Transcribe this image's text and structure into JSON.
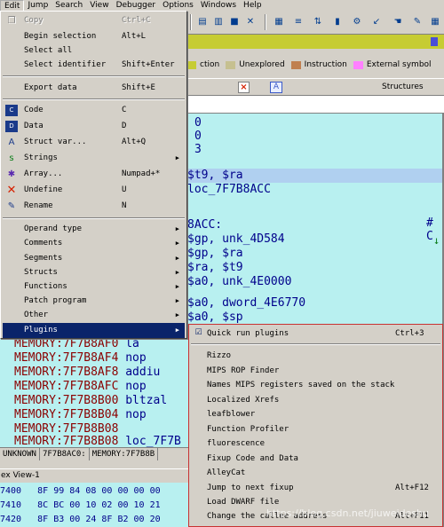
{
  "menubar": {
    "items": [
      "Edit",
      "Jump",
      "Search",
      "View",
      "Debugger",
      "Options",
      "Windows",
      "Help"
    ]
  },
  "legend": {
    "items": [
      {
        "label": "ction",
        "color": "#c6cc33"
      },
      {
        "label": "Unexplored",
        "color": "#c6c090"
      },
      {
        "label": "Instruction",
        "color": "#c08050"
      },
      {
        "label": "External symbol",
        "color": "#ff80ff"
      }
    ]
  },
  "tabs": {
    "close": "×",
    "structs_icon": "A",
    "structs": "Structures"
  },
  "listing": {
    "top_lines": [
      "0",
      "0",
      "3"
    ],
    "lines": [
      {
        "text": "$t9, $ra",
        "selected": true
      },
      {
        "text": "loc_7F7B8ACC"
      },
      {
        "text": "8ACC:"
      },
      {
        "text": "$gp, unk_4D584"
      },
      {
        "text": "$gp, $ra"
      },
      {
        "text": "$ra, $t9"
      },
      {
        "text": "$a0, unk_4E0000"
      },
      {
        "text": "$a0, dword_4E6770"
      },
      {
        "text": "$a0, $sp"
      }
    ],
    "comment": "# C",
    "memory_rows": [
      {
        "addr": "MEMORY:7F7B8AF0",
        "op": "la"
      },
      {
        "addr": "MEMORY:7F7B8AF4",
        "op": "nop"
      },
      {
        "addr": "MEMORY:7F7B8AF8",
        "op": "addiu"
      },
      {
        "addr": "MEMORY:7F7B8AFC",
        "op": "nop"
      },
      {
        "addr": "MEMORY:7F7B8B00",
        "op": "bltzal"
      },
      {
        "addr": "MEMORY:7F7B8B04",
        "op": "nop"
      },
      {
        "addr": "MEMORY:7F7B8B08",
        "op": ""
      },
      {
        "addr": "MEMORY:7F7B8B08",
        "op": "loc_7F7B"
      }
    ]
  },
  "status": {
    "unknown": "UNKNOWN",
    "addr": "7F7B8AC0:",
    "loc": "MEMORY:7F7B8B"
  },
  "hex": {
    "title": "ex View-1",
    "rows": [
      {
        "addr": "7400",
        "bytes": "8F 99 84 08 00 00 00 00"
      },
      {
        "addr": "7410",
        "bytes": "8C BC 00 10 02 00 10 21"
      },
      {
        "addr": "7420",
        "bytes": "8F B3 00 24 8F B2 00 20"
      }
    ]
  },
  "edit_menu": {
    "items": [
      {
        "label": "Copy",
        "shortcut": "Ctrl+C",
        "disabled": true,
        "icon": "copy-icon"
      },
      {
        "label": "Begin selection",
        "shortcut": "Alt+L"
      },
      {
        "label": "Select all",
        "shortcut": ""
      },
      {
        "label": "Select identifier",
        "shortcut": "Shift+Enter"
      },
      {
        "sep": true
      },
      {
        "label": "Export data",
        "shortcut": "Shift+E"
      },
      {
        "sep": true
      },
      {
        "label": "Code",
        "shortcut": "C",
        "icon": "code-icon"
      },
      {
        "label": "Data",
        "shortcut": "D",
        "icon": "data-icon"
      },
      {
        "label": "Struct var...",
        "shortcut": "Alt+Q",
        "icon": "struct-var-icon"
      },
      {
        "label": "Strings",
        "shortcut": "",
        "submenu": true,
        "icon": "strings-icon"
      },
      {
        "label": "Array...",
        "shortcut": "Numpad+*",
        "icon": "array-icon"
      },
      {
        "label": "Undefine",
        "shortcut": "U",
        "icon": "undefine-icon"
      },
      {
        "label": "Rename",
        "shortcut": "N",
        "icon": "rename-icon"
      },
      {
        "sep": true
      },
      {
        "label": "Operand type",
        "submenu": true
      },
      {
        "label": "Comments",
        "submenu": true
      },
      {
        "label": "Segments",
        "submenu": true
      },
      {
        "label": "Structs",
        "submenu": true
      },
      {
        "label": "Functions",
        "submenu": true
      },
      {
        "label": "Patch program",
        "submenu": true
      },
      {
        "label": "Other",
        "submenu": true
      },
      {
        "label": "Plugins",
        "submenu": true,
        "highlighted": true
      }
    ]
  },
  "plugins_menu": {
    "items": [
      {
        "label": "Quick run plugins",
        "shortcut": "Ctrl+3",
        "icon": "quick-run-icon"
      },
      {
        "sep": true
      },
      {
        "label": "Rizzo"
      },
      {
        "label": "MIPS ROP Finder"
      },
      {
        "label": "Names MIPS registers saved on the stack"
      },
      {
        "label": "Localized Xrefs"
      },
      {
        "label": "leafblower"
      },
      {
        "label": "Function Profiler"
      },
      {
        "label": "fluorescence"
      },
      {
        "label": "Fixup Code and Data"
      },
      {
        "label": "AlleyCat"
      },
      {
        "label": "Jump to next fixup",
        "shortcut": "Alt+F12"
      },
      {
        "label": "Load DWARF file"
      },
      {
        "label": "Change the callee address",
        "shortcut": "Alt+F11"
      }
    ]
  },
  "watermark": "https://blog.csdn.net/jiuweideshu"
}
